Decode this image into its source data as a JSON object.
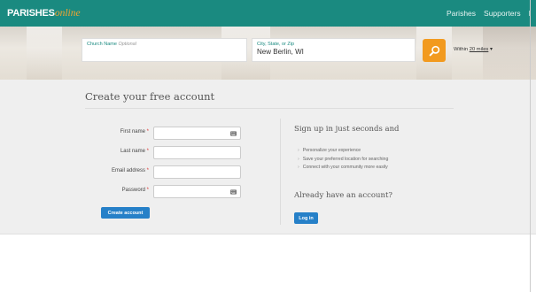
{
  "nav": {
    "logo_main": "PARISHES",
    "logo_accent": "online",
    "links": [
      "Parishes",
      "Supporters",
      "I"
    ]
  },
  "search": {
    "church_label": "Church Name",
    "church_optional": "Optional",
    "church_value": "",
    "city_label": "City, State, or Zip",
    "city_value": "New Berlin, WI",
    "within_prefix": "Within",
    "within_distance": "20 miles",
    "within_caret": "▾"
  },
  "form": {
    "title": "Create your free account",
    "fields": [
      {
        "label": "First name",
        "required": "*",
        "value": "",
        "has_icon": true
      },
      {
        "label": "Last name",
        "required": "*",
        "value": "",
        "has_icon": false
      },
      {
        "label": "Email address",
        "required": "*",
        "value": "",
        "has_icon": false
      },
      {
        "label": "Password",
        "required": "*",
        "value": "",
        "has_icon": true
      }
    ],
    "submit_label": "Create account"
  },
  "signup": {
    "heading": "Sign up in just seconds and",
    "benefits": [
      "Personalize your experience",
      "Save your preferred location for searching",
      "Connect with your community more easily"
    ],
    "login_heading": "Already have an account?",
    "login_label": "Log in"
  },
  "colors": {
    "nav_bg": "#1a8a80",
    "accent_orange": "#f29a1f",
    "button_blue": "#2680c8",
    "required_red": "#d33"
  },
  "icons": {
    "search": "magnifier-icon",
    "field": "keyboard-icon"
  }
}
